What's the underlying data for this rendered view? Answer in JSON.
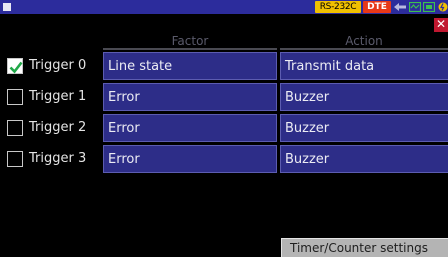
{
  "status": {
    "interface": "RS-232C",
    "mode": "DTE",
    "colors": {
      "bar": "#2c2c9c",
      "interface_tag": "#f0c000",
      "mode_tag": "#e83818",
      "icon": "#3cc050"
    }
  },
  "window": {
    "close_symbol": "✕"
  },
  "table": {
    "headers": {
      "factor": "Factor",
      "action": "Action"
    },
    "rows": [
      {
        "label": "Trigger 0",
        "checked": true,
        "factor": "Line state",
        "action": "Transmit data"
      },
      {
        "label": "Trigger 1",
        "checked": false,
        "factor": "Error",
        "action": "Buzzer"
      },
      {
        "label": "Trigger 2",
        "checked": false,
        "factor": "Error",
        "action": "Buzzer"
      },
      {
        "label": "Trigger 3",
        "checked": false,
        "factor": "Error",
        "action": "Buzzer"
      }
    ]
  },
  "footer": {
    "timer_button": "Timer/Counter settings"
  }
}
